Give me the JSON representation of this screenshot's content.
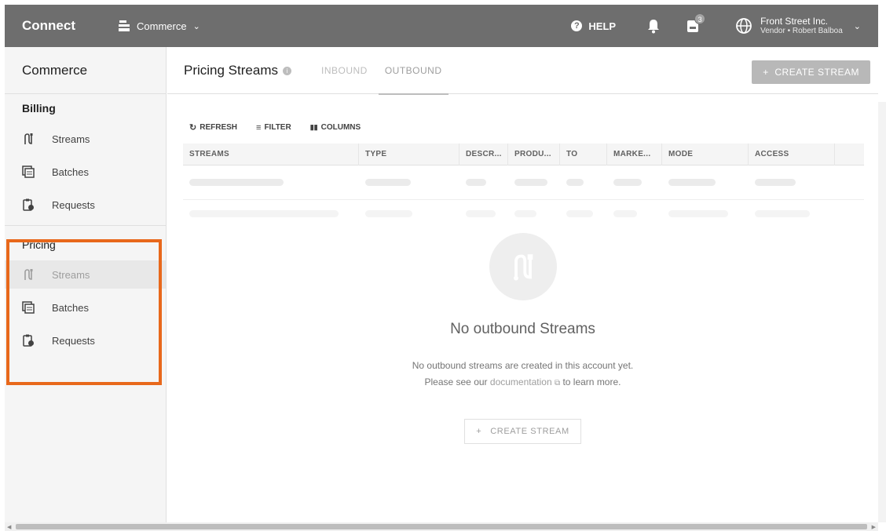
{
  "app": {
    "brand": "Connect",
    "module": "Commerce"
  },
  "topbar": {
    "help_label": "HELP",
    "notifications_badge": "3",
    "account_name": "Front Street Inc.",
    "account_sub": "Vendor • Robert Balboa"
  },
  "sidebar": {
    "title": "Commerce",
    "billing": {
      "label": "Billing",
      "items": [
        {
          "label": "Streams",
          "icon": "streams-icon"
        },
        {
          "label": "Batches",
          "icon": "batches-icon"
        },
        {
          "label": "Requests",
          "icon": "requests-icon"
        }
      ]
    },
    "pricing": {
      "label": "Pricing",
      "items": [
        {
          "label": "Streams",
          "icon": "streams-icon",
          "active": true
        },
        {
          "label": "Batches",
          "icon": "batches-icon"
        },
        {
          "label": "Requests",
          "icon": "requests-icon"
        }
      ]
    },
    "highlight_color": "#e8681b"
  },
  "main": {
    "title": "Pricing Streams",
    "tabs": [
      {
        "label": "INBOUND",
        "active": false
      },
      {
        "label": "OUTBOUND",
        "active": true
      }
    ],
    "create_button": "CREATE STREAM",
    "toolbar": {
      "refresh": "REFRESH",
      "filter": "FILTER",
      "columns": "COLUMNS"
    },
    "table": {
      "columns": [
        "STREAMS",
        "TYPE",
        "DESCR...",
        "PRODU...",
        "TO",
        "MARKE...",
        "MODE",
        "ACCESS"
      ]
    },
    "empty": {
      "title": "No outbound Streams",
      "line1": "No outbound streams are created in this account yet.",
      "line2_prefix": "Please see our",
      "link": "documentation",
      "line2_suffix": "to learn more.",
      "button": "CREATE STREAM"
    }
  }
}
